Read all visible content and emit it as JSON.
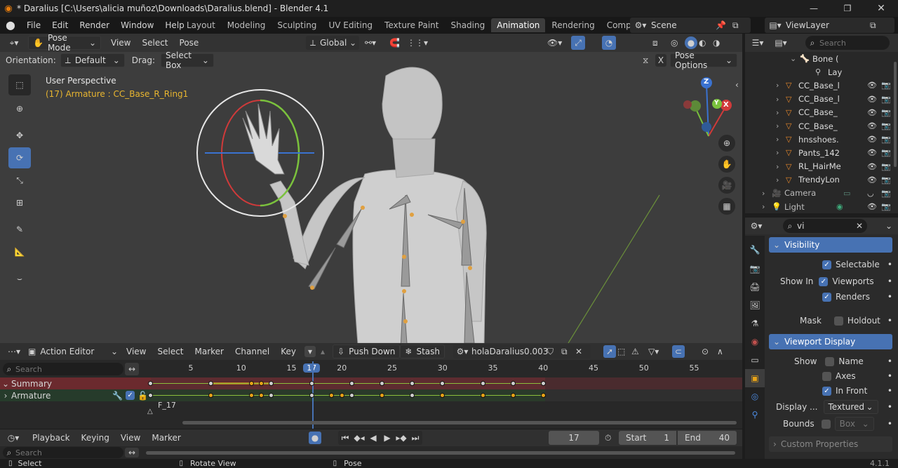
{
  "window": {
    "title": "* Daralius [C:\\Users\\alicia muñoz\\Downloads\\Daralius.blend] - Blender 4.1"
  },
  "menu": [
    "File",
    "Edit",
    "Render",
    "Window",
    "Help"
  ],
  "workspaces": [
    "Layout",
    "Modeling",
    "Sculpting",
    "UV Editing",
    "Texture Paint",
    "Shading",
    "Animation",
    "Rendering",
    "Compositin"
  ],
  "active_workspace": "Animation",
  "scene": {
    "label": "Scene"
  },
  "viewlayer": {
    "label": "ViewLayer"
  },
  "viewport_header": {
    "mode": "Pose Mode",
    "menus": [
      "View",
      "Select",
      "Pose"
    ],
    "transform": "Global"
  },
  "tool_settings": {
    "orientation_label": "Orientation:",
    "orientation": "Default",
    "drag_label": "Drag:",
    "drag": "Select Box",
    "pose_options": "Pose Options"
  },
  "viewport": {
    "perspective": "User Perspective",
    "active": "(17) Armature : CC_Base_R_Ring1",
    "gizmo": {
      "x": "X",
      "y": "Y",
      "z": "Z"
    }
  },
  "outliner": {
    "search_placeholder": "Search",
    "items": [
      {
        "label": "Bone (",
        "type": "bone"
      },
      {
        "label": "Lay",
        "type": "layer"
      },
      {
        "label": "CC_Base_l",
        "type": "mesh"
      },
      {
        "label": "CC_Base_l",
        "type": "mesh"
      },
      {
        "label": "CC_Base_",
        "type": "mesh"
      },
      {
        "label": "CC_Base_",
        "type": "mesh"
      },
      {
        "label": "hnsshoes.",
        "type": "mesh"
      },
      {
        "label": "Pants_142",
        "type": "mesh"
      },
      {
        "label": "RL_HairMe",
        "type": "mesh"
      },
      {
        "label": "TrendyLon",
        "type": "mesh"
      },
      {
        "label": "Camera",
        "type": "camera"
      },
      {
        "label": "Light",
        "type": "light"
      }
    ]
  },
  "properties": {
    "search_value": "vi",
    "visibility": {
      "header": "Visibility",
      "selectable": "Selectable",
      "show_in": "Show In",
      "viewports": "Viewports",
      "renders": "Renders",
      "mask": "Mask",
      "holdout": "Holdout"
    },
    "viewport_display": {
      "header": "Viewport Display",
      "show": "Show",
      "name": "Name",
      "axes": "Axes",
      "in_front": "In Front",
      "display_as_label": "Display ...",
      "display_as": "Textured",
      "bounds_label": "Bounds",
      "bounds": "Box"
    },
    "custom_properties": "Custom Properties"
  },
  "action_editor": {
    "mode": "Action Editor",
    "menus": [
      "View",
      "Select",
      "Marker",
      "Channel",
      "Key"
    ],
    "push_down": "Push Down",
    "stash": "Stash",
    "action_name": "holaDaralius0.003",
    "search_placeholder": "Search",
    "ruler": [
      "5",
      "10",
      "15",
      "17",
      "20",
      "25",
      "30",
      "35",
      "40",
      "45",
      "50",
      "55"
    ],
    "current_frame": "17",
    "channels": [
      {
        "label": "Summary"
      },
      {
        "label": "Armature"
      }
    ],
    "marker": "F_17"
  },
  "timeline": {
    "menus": [
      "Playback",
      "Keying",
      "View",
      "Marker"
    ],
    "frame": "17",
    "start_label": "Start",
    "start": "1",
    "end_label": "End",
    "end": "40"
  },
  "statusbar": {
    "select": "Select",
    "rotate": "Rotate View",
    "pose": "Pose",
    "version": "4.1.1"
  },
  "colors": {
    "accent": "#4772b3",
    "selected_key": "#e8a317",
    "header": "#303030",
    "panel": "#2b2b2b",
    "viewport_bg": "#3d3d3d",
    "summary": "#6b2a2e",
    "armature_row": "#263b2b"
  }
}
